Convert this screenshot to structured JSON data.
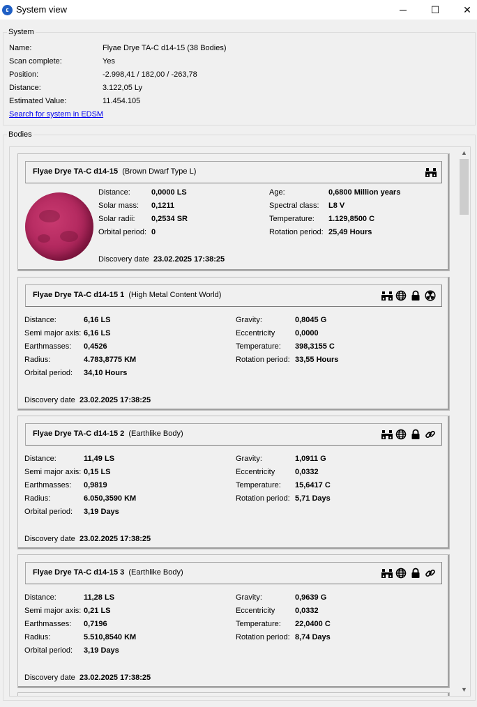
{
  "window": {
    "title": "System view",
    "minimize": "─",
    "maximize": "☐",
    "close": "✕"
  },
  "system": {
    "legend": "System",
    "rows": [
      {
        "label": "Name:",
        "value": "Flyae Drye TA-C d14-15 (38 Bodies)"
      },
      {
        "label": "Scan complete:",
        "value": "Yes"
      },
      {
        "label": "Position:",
        "value": "-2.998,41 / 182,00 / -263,78"
      },
      {
        "label": "Distance:",
        "value": "3.122,05 Ly"
      },
      {
        "label": "Estimated Value:",
        "value": "11.454.105"
      }
    ],
    "edsm_link": "Search for system in EDSM"
  },
  "bodies_legend": "Bodies",
  "star": {
    "name": "Flyae Drye TA-C d14-15",
    "type": "(Brown Dwarf Type L)",
    "left": [
      {
        "label": "Distance:",
        "value": "0,0000 LS"
      },
      {
        "label": "Solar mass:",
        "value": "0,1211"
      },
      {
        "label": "Solar radii:",
        "value": "0,2534 SR"
      },
      {
        "label": "Orbital period:",
        "value": "0"
      }
    ],
    "right": [
      {
        "label": "Age:",
        "value": "0,6800 Million years"
      },
      {
        "label": "Spectral class:",
        "value": "L8 V"
      },
      {
        "label": "Temperature:",
        "value": "1.129,8500 C"
      },
      {
        "label": "Rotation period:",
        "value": "25,49 Hours"
      }
    ],
    "discovery_label": "Discovery date",
    "discovery_value": "23.02.2025 17:38:25",
    "icons": [
      "binoculars-icon"
    ]
  },
  "planets": [
    {
      "name": "Flyae Drye TA-C d14-15 1",
      "type": "(High Metal Content World)",
      "left": [
        {
          "label": "Distance:",
          "value": "6,16 LS"
        },
        {
          "label": "Semi major axis:",
          "value": "6,16 LS"
        },
        {
          "label": "Earthmasses:",
          "value": "0,4526"
        },
        {
          "label": "Radius:",
          "value": "4.783,8775 KM"
        },
        {
          "label": "Orbital period:",
          "value": "34,10 Hours"
        }
      ],
      "right": [
        {
          "label": "Gravity:",
          "value": "0,8045 G"
        },
        {
          "label": "Eccentricity",
          "value": "0,0000"
        },
        {
          "label": "Temperature:",
          "value": "398,3155 C"
        },
        {
          "label": "Rotation period:",
          "value": "33,55 Hours"
        }
      ],
      "discovery_label": "Discovery date",
      "discovery_value": "23.02.2025 17:38:25",
      "icons": [
        "binoculars-icon",
        "globe-icon",
        "lock-icon",
        "radiation-icon"
      ]
    },
    {
      "name": "Flyae Drye TA-C d14-15 2",
      "type": "(Earthlike Body)",
      "left": [
        {
          "label": "Distance:",
          "value": "11,49 LS"
        },
        {
          "label": "Semi major axis:",
          "value": "0,15 LS"
        },
        {
          "label": "Earthmasses:",
          "value": "0,9819"
        },
        {
          "label": "Radius:",
          "value": "6.050,3590 KM"
        },
        {
          "label": "Orbital period:",
          "value": "3,19 Days"
        }
      ],
      "right": [
        {
          "label": "Gravity:",
          "value": "1,0911 G"
        },
        {
          "label": "Eccentricity",
          "value": "0,0332"
        },
        {
          "label": "Temperature:",
          "value": "15,6417 C"
        },
        {
          "label": "Rotation period:",
          "value": "5,71 Days"
        }
      ],
      "discovery_label": "Discovery date",
      "discovery_value": "23.02.2025 17:38:25",
      "icons": [
        "binoculars-icon",
        "globe-icon",
        "lock-icon",
        "link-icon"
      ]
    },
    {
      "name": "Flyae Drye TA-C d14-15 3",
      "type": "(Earthlike Body)",
      "left": [
        {
          "label": "Distance:",
          "value": "11,28 LS"
        },
        {
          "label": "Semi major axis:",
          "value": "0,21 LS"
        },
        {
          "label": "Earthmasses:",
          "value": "0,7196"
        },
        {
          "label": "Radius:",
          "value": "5.510,8540 KM"
        },
        {
          "label": "Orbital period:",
          "value": "3,19 Days"
        }
      ],
      "right": [
        {
          "label": "Gravity:",
          "value": "0,9639 G"
        },
        {
          "label": "Eccentricity",
          "value": "0,0332"
        },
        {
          "label": "Temperature:",
          "value": "22,0400 C"
        },
        {
          "label": "Rotation period:",
          "value": "8,74 Days"
        }
      ],
      "discovery_label": "Discovery date",
      "discovery_value": "23.02.2025 17:38:25",
      "icons": [
        "binoculars-icon",
        "globe-icon",
        "lock-icon",
        "link-icon"
      ]
    }
  ]
}
